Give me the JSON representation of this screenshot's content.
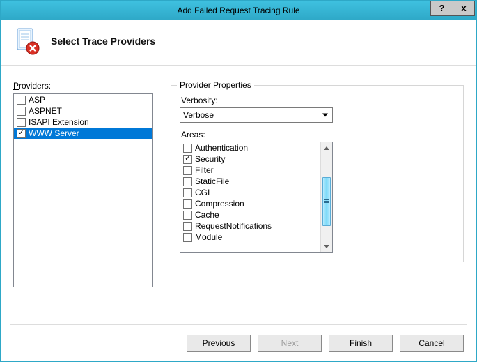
{
  "window": {
    "title": "Add Failed Request Tracing Rule",
    "help_label": "?",
    "close_label": "x"
  },
  "header": {
    "title": "Select Trace Providers"
  },
  "providers": {
    "label_pre": "P",
    "label_rest": "roviders:",
    "items": [
      {
        "label": "ASP",
        "checked": false,
        "selected": false
      },
      {
        "label": "ASPNET",
        "checked": false,
        "selected": false
      },
      {
        "label": "ISAPI Extension",
        "checked": false,
        "selected": false
      },
      {
        "label": "WWW Server",
        "checked": true,
        "selected": true
      }
    ]
  },
  "properties": {
    "group_title": "Provider Properties",
    "verbosity_label_pre": "V",
    "verbosity_label_rest": "erbosity:",
    "verbosity_value": "Verbose",
    "areas_label_pre": "A",
    "areas_label_rest": "reas:",
    "areas": [
      {
        "label": "Authentication",
        "checked": false
      },
      {
        "label": "Security",
        "checked": true
      },
      {
        "label": "Filter",
        "checked": false
      },
      {
        "label": "StaticFile",
        "checked": false
      },
      {
        "label": "CGI",
        "checked": false
      },
      {
        "label": "Compression",
        "checked": false
      },
      {
        "label": "Cache",
        "checked": false
      },
      {
        "label": "RequestNotifications",
        "checked": false
      },
      {
        "label": "Module",
        "checked": false
      }
    ]
  },
  "buttons": {
    "previous": "Previous",
    "next": "Next",
    "finish": "Finish",
    "cancel": "Cancel"
  },
  "checkmark": "✓"
}
